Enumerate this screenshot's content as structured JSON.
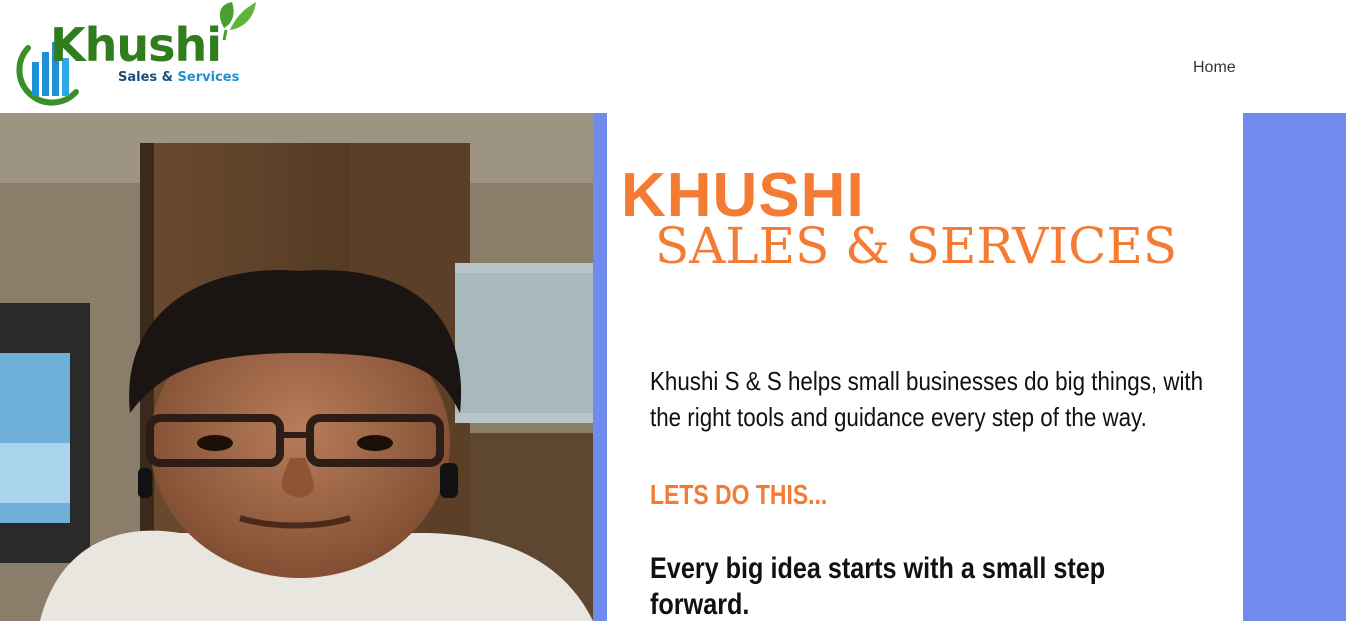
{
  "header": {
    "logo": {
      "word": "Khushi",
      "sub_part1": "Sales & ",
      "sub_part2": "Services"
    },
    "nav": {
      "home": "Home"
    }
  },
  "hero": {
    "title": "KHUSHI",
    "subtitle": "SALES & SERVICES",
    "description": "Khushi S & S helps small businesses do big things, with the right tools and guidance every step of the way.",
    "cta": "LETS DO THIS...",
    "tagline": "Every big idea starts with a small step forward."
  },
  "colors": {
    "accent_orange": "#f47b34",
    "accent_blue": "#6f8bee",
    "logo_green": "#2f7d1d",
    "logo_blue": "#1f8fd6"
  }
}
